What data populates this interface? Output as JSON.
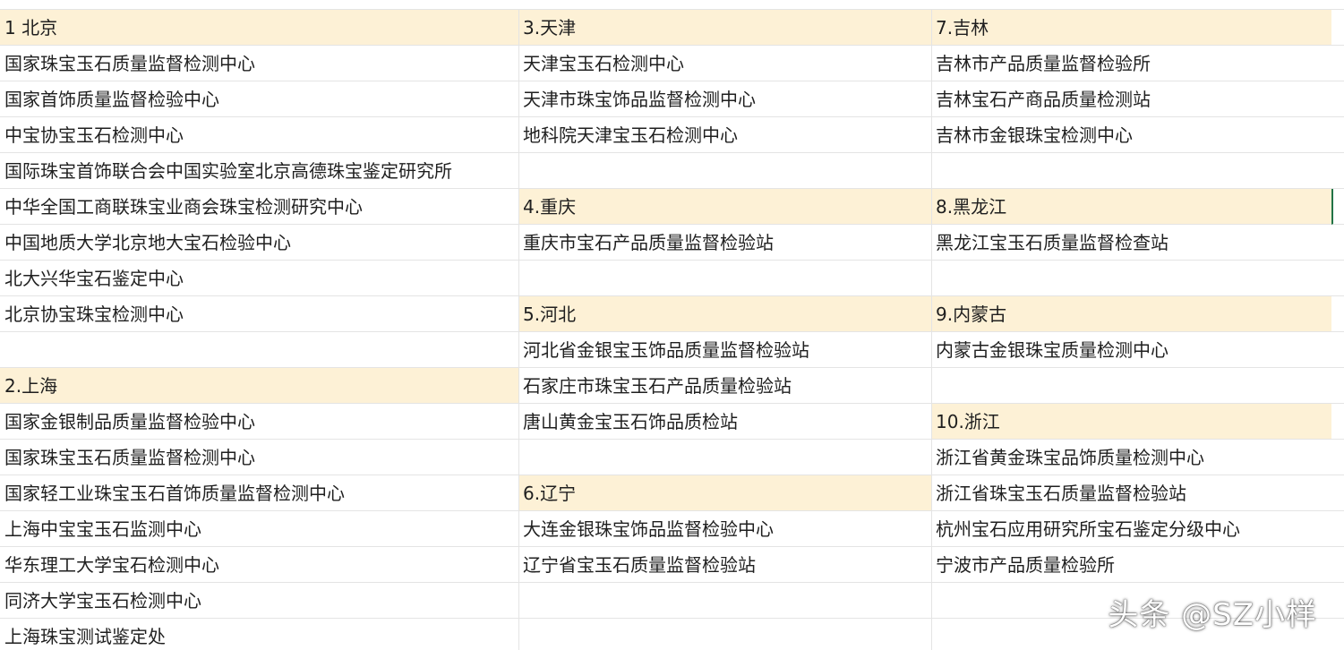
{
  "highlight_color": "#fdf1d6",
  "grid_color": "#e4e4e4",
  "selection_color": "#217346",
  "rows": [
    [
      "1 北京",
      "3.天津",
      "7.吉林",
      ""
    ],
    [
      "国家珠宝玉石质量监督检测中心",
      "天津宝玉石检测中心",
      "吉林市产品质量监督检验所",
      ""
    ],
    [
      "国家首饰质量监督检验中心",
      "天津市珠宝饰品监督检测中心",
      "吉林宝石产商品质量检测站",
      ""
    ],
    [
      "中宝协宝玉石检测中心",
      "地科院天津宝玉石检测中心",
      "吉林市金银珠宝检测中心",
      ""
    ],
    [
      "国际珠宝首饰联合会中国实验室北京高德珠宝鉴定研究所",
      "",
      "",
      ""
    ],
    [
      "中华全国工商联珠宝业商会珠宝检测研究中心",
      "4.重庆",
      "8.黑龙江",
      ""
    ],
    [
      "中国地质大学北京地大宝石检验中心",
      "重庆市宝石产品质量监督检验站",
      "黑龙江宝玉石质量监督检查站",
      ""
    ],
    [
      "北大兴华宝石鉴定中心",
      "",
      "",
      ""
    ],
    [
      "北京协宝珠宝检测中心",
      "5.河北",
      "9.内蒙古",
      ""
    ],
    [
      "",
      "河北省金银宝玉饰品质量监督检验站",
      "内蒙古金银珠宝质量检测中心",
      ""
    ],
    [
      "2.上海",
      "石家庄市珠宝玉石产品质量检验站",
      "",
      ""
    ],
    [
      "国家金银制品质量监督检验中心",
      "唐山黄金宝玉石饰品质检站",
      "10.浙江",
      ""
    ],
    [
      "国家珠宝玉石质量监督检测中心",
      "",
      "浙江省黄金珠宝品饰质量检测中心",
      ""
    ],
    [
      "国家轻工业珠宝玉石首饰质量监督检测中心",
      "6.辽宁",
      "浙江省珠宝玉石质量监督检验站",
      ""
    ],
    [
      "上海中宝宝玉石监测中心",
      "大连金银珠宝饰品监督检验中心",
      "杭州宝石应用研究所宝石鉴定分级中心",
      ""
    ],
    [
      "华东理工大学宝石检测中心",
      "辽宁省宝玉石质量监督检验站",
      "宁波市产品质量检验所",
      ""
    ],
    [
      "同济大学宝玉石检测中心",
      "",
      "",
      ""
    ],
    [
      "上海珠宝测试鉴定处",
      "",
      "",
      ""
    ]
  ],
  "highlighted_cells": [
    [
      0,
      0
    ],
    [
      0,
      1
    ],
    [
      0,
      2
    ],
    [
      5,
      1
    ],
    [
      5,
      2
    ],
    [
      8,
      1
    ],
    [
      8,
      2
    ],
    [
      10,
      0
    ],
    [
      11,
      2
    ],
    [
      13,
      1
    ]
  ],
  "watermark": "头条 @SZ小样"
}
